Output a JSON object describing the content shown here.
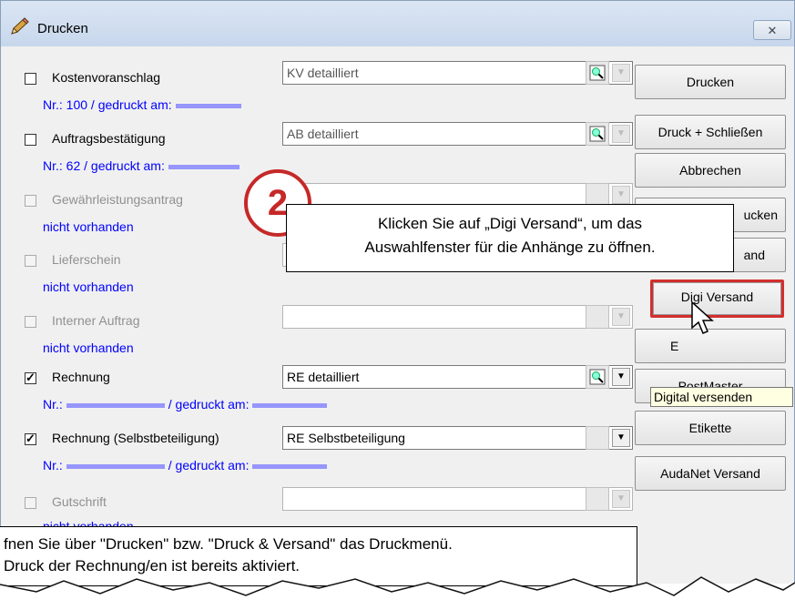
{
  "window": {
    "title": "Drucken",
    "close_glyph": "✕"
  },
  "documents": [
    {
      "label": "Kostenvoranschlag",
      "checked": false,
      "enabled": true,
      "info": "Nr.: 100 / gedruckt am:",
      "combo": "KV detailliert"
    },
    {
      "label": "Auftragsbestätigung",
      "checked": false,
      "enabled": true,
      "info": "Nr.: 62 / gedruckt am:",
      "combo": "AB detailliert"
    },
    {
      "label": "Gewährleistungsantrag",
      "checked": false,
      "enabled": false,
      "info": "nicht vorhanden",
      "combo": ""
    },
    {
      "label": "Lieferschein",
      "checked": false,
      "enabled": false,
      "info": "nicht vorhanden",
      "combo": ""
    },
    {
      "label": "Interner Auftrag",
      "checked": false,
      "enabled": false,
      "info": "nicht vorhanden",
      "combo": ""
    },
    {
      "label": "Rechnung",
      "checked": true,
      "enabled": true,
      "info_a": "Nr.:",
      "info_b": "/ gedruckt am:",
      "combo": "RE detailliert"
    },
    {
      "label": "Rechnung (Selbstbeteiligung)",
      "checked": true,
      "enabled": true,
      "info_a": "Nr.:",
      "info_b": "/ gedruckt am:",
      "combo": "RE Selbstbeteiligung"
    },
    {
      "label": "Gutschrift",
      "checked": false,
      "enabled": false,
      "info": "nicht vorhanden",
      "combo": ""
    }
  ],
  "buttons": {
    "drucken": "Drucken",
    "druck_schliessen": "Druck + Schließen",
    "abbrechen": "Abbrechen",
    "btn4_partial": "ucken",
    "btn5_partial": "and",
    "digi_versand": "Digi Versand",
    "btn7_partial": "E",
    "postmaster": "PostMaster",
    "etikette": "Etikette",
    "audanet": "AudaNet Versand"
  },
  "tooltip": "Digital versenden",
  "step_number": "2",
  "callout_top": {
    "line1": "Klicken Sie auf „Digi Versand“, um das",
    "line2": "Auswahlfenster für die Anhänge zu öffnen."
  },
  "callout_bottom": {
    "line1": "fnen Sie über \"Drucken\" bzw. \"Druck & Versand\" das Druckmenü.",
    "line2": "Druck der Rechnung/en ist bereits aktiviert."
  },
  "colors": {
    "accent_red": "#d42e2e",
    "info_blue": "#0000ff",
    "tooltip_bg": "#ffffe1"
  }
}
